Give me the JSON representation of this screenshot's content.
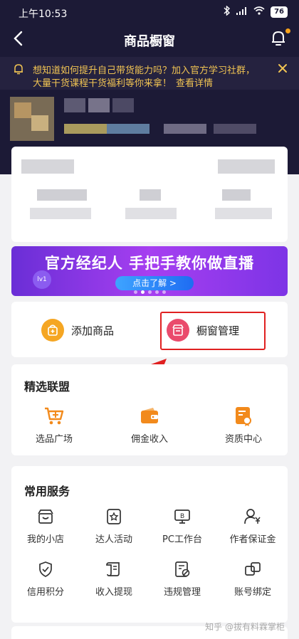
{
  "status": {
    "time": "上午10:53",
    "battery": "76"
  },
  "nav": {
    "title": "商品橱窗"
  },
  "notice": {
    "line1": "想知道如何提升自己带货能力吗？加入官方学习社群，",
    "line2": "大量干货课程干货福利等你来拿！",
    "link": "查看详情"
  },
  "banner": {
    "headline": "官方经纪人 手把手教你做直播",
    "cta": "点击了解 >",
    "badge": "lv1"
  },
  "quick": {
    "add_label": "添加商品",
    "manage_label": "橱窗管理"
  },
  "alliance": {
    "title": "精选联盟",
    "items": [
      {
        "label": "选品广场",
        "icon": "cart-plus-icon"
      },
      {
        "label": "佣金收入",
        "icon": "wallet-icon"
      },
      {
        "label": "资质中心",
        "icon": "certificate-icon"
      }
    ]
  },
  "services": {
    "title": "常用服务",
    "items": [
      {
        "label": "我的小店",
        "icon": "shop-icon"
      },
      {
        "label": "达人活动",
        "icon": "star-card-icon"
      },
      {
        "label": "PC工作台",
        "icon": "monitor-icon"
      },
      {
        "label": "作者保证金",
        "icon": "user-yen-icon"
      },
      {
        "label": "信用积分",
        "icon": "shield-check-icon"
      },
      {
        "label": "收入提现",
        "icon": "scroll-icon"
      },
      {
        "label": "违规管理",
        "icon": "report-icon"
      },
      {
        "label": "账号绑定",
        "icon": "link-squares-icon"
      }
    ]
  },
  "watermark": "知乎 @拔有料霖掌柜",
  "colors": {
    "accent_orange": "#f28a1c",
    "alert_red": "#e02020",
    "hero_bg": "#1c1a36",
    "manage_icon": "#ea4b6c"
  }
}
